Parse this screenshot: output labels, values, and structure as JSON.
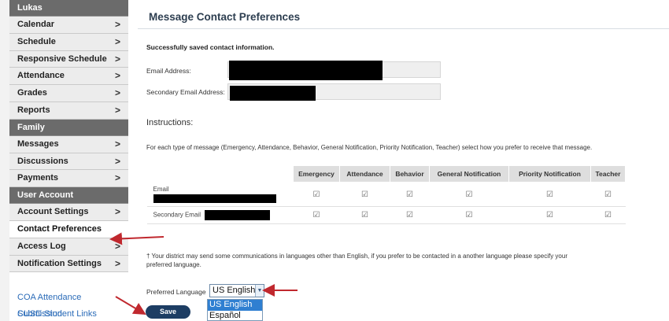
{
  "sidebar": {
    "student_name": "Lukas",
    "student_items": [
      {
        "label": "Calendar",
        "chevron": ">"
      },
      {
        "label": "Schedule",
        "chevron": ">"
      },
      {
        "label": "Responsive Schedule",
        "chevron": ">"
      },
      {
        "label": "Attendance",
        "chevron": ">"
      },
      {
        "label": "Grades",
        "chevron": ">"
      },
      {
        "label": "Reports",
        "chevron": ">"
      }
    ],
    "family_header": "Family",
    "family_items": [
      {
        "label": "Messages",
        "chevron": ">"
      },
      {
        "label": "Discussions",
        "chevron": ">"
      },
      {
        "label": "Payments",
        "chevron": ">"
      }
    ],
    "account_header": "User Account",
    "account_items": [
      {
        "label": "Account Settings",
        "chevron": ">"
      },
      {
        "label": "Contact Preferences",
        "chevron": ""
      },
      {
        "label": "Access Log",
        "chevron": ">"
      },
      {
        "label": "Notification Settings",
        "chevron": ">"
      }
    ],
    "links": [
      "COA Attendance Submission",
      "CUSD Student Links"
    ]
  },
  "main": {
    "title": "Message Contact Preferences",
    "success_message": "Successfully saved contact information.",
    "email_label": "Email Address:",
    "secondary_email_label": "Secondary Email Address:",
    "instructions_title": "Instructions:",
    "instructions_text": "For each type of message (Emergency, Attendance, Behavior, General Notification, Priority Notification, Teacher) select how you prefer to receive that message.",
    "table": {
      "columns": [
        "Emergency",
        "Attendance",
        "Behavior",
        "General Notification",
        "Priority Notification",
        "Teacher"
      ],
      "rows": [
        {
          "label": "Email",
          "checks": [
            "☑",
            "☑",
            "☑",
            "☑",
            "☑",
            "☑"
          ]
        },
        {
          "label": "Secondary Email",
          "checks": [
            "☑",
            "☑",
            "☑",
            "☑",
            "☑",
            "☑"
          ]
        }
      ]
    },
    "language_note": "† Your district may send some communications in languages other than English, if you prefer to be contacted in a another language please specify your preferred language.",
    "preferred_language_label": "Preferred Language",
    "language_selected": "US English",
    "language_options": [
      "US English",
      "Español"
    ],
    "save_label": "Save"
  },
  "colors": {
    "sidebar_header": "#6b6b6b",
    "nav_item_bg": "#ececec",
    "link": "#2a6bb8",
    "save_button": "#1d3d63",
    "annotation_arrow": "#c0282e",
    "dropdown_selected": "#2f7fd1"
  }
}
